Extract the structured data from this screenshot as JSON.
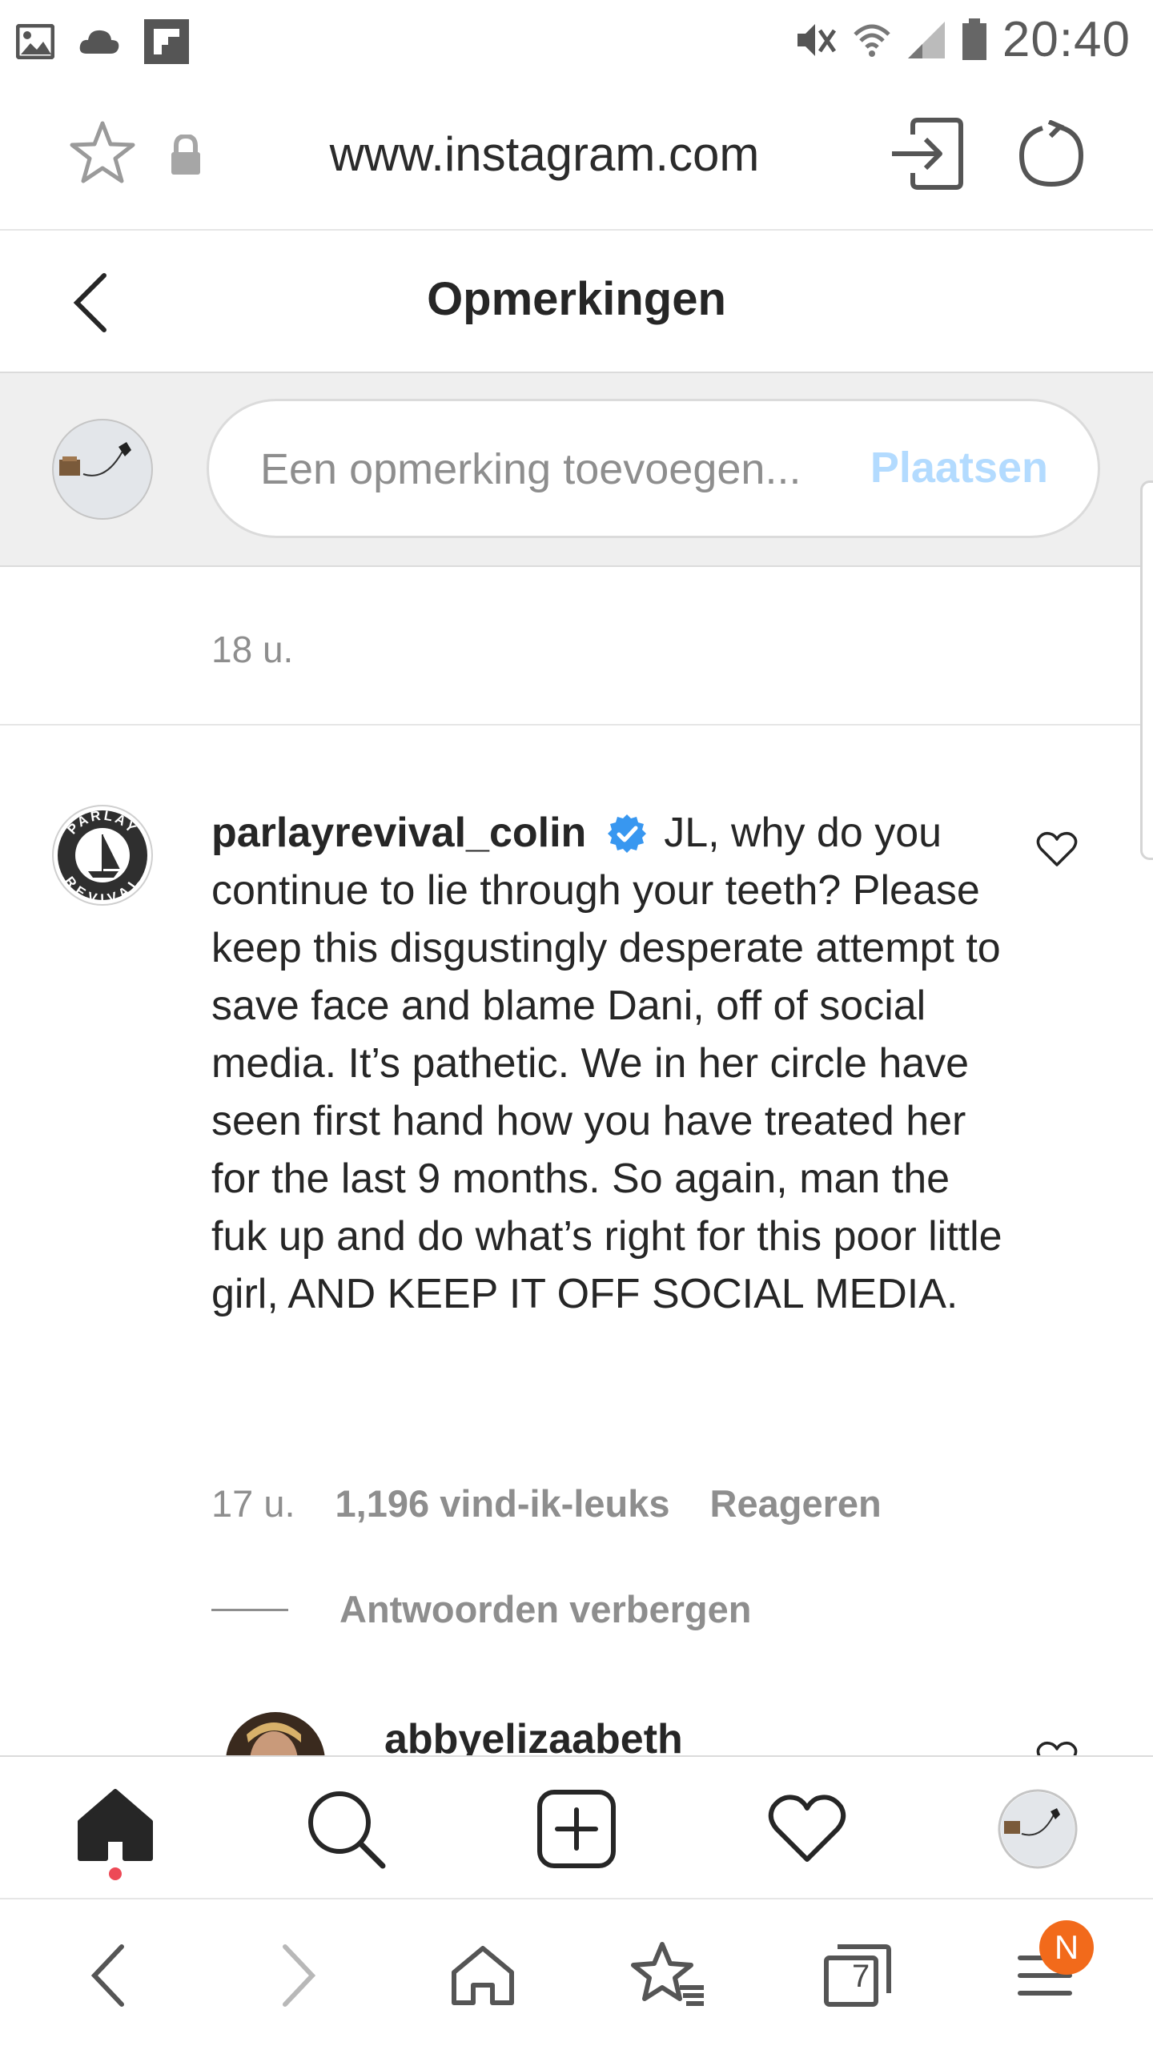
{
  "status_bar": {
    "time": "20:40",
    "left_icons": [
      "image-icon",
      "cloud-icon",
      "flipboard-icon"
    ],
    "right_icons": [
      "mute-vibrate-icon",
      "wifi-icon",
      "signal-icon",
      "battery-icon"
    ]
  },
  "browser": {
    "url": "www.instagram.com",
    "icons": [
      "star-icon",
      "lock-icon",
      "login-icon",
      "reload-icon"
    ]
  },
  "header": {
    "title": "Opmerkingen",
    "back_icon": "chevron-left-icon"
  },
  "add_comment": {
    "placeholder": "Een opmerking toevoegen...",
    "post_label": "Plaatsen",
    "post_color": "#b3dbff"
  },
  "previous_comment": {
    "time": "18 u."
  },
  "comment": {
    "username": "parlayrevival_colin",
    "verified": true,
    "verified_color": "#3897f0",
    "text": "JL, why do you continue to lie through your teeth? Please keep this disgustingly desperate attempt to save face and blame Dani, off of social media. It’s pathetic. We in her circle have seen first hand how you have treated her for the last 9 months. So again, man the fuk up and do what’s right for this poor little girl, AND KEEP IT OFF SOCIAL MEDIA.",
    "avatar_text_top": "PARLAY",
    "avatar_text_bottom": "REVIVAL",
    "time": "17 u.",
    "likes": "1,196 vind-ik-leuks",
    "reply_label": "Reageren",
    "toggle_replies": "Antwoorden verbergen"
  },
  "reply": {
    "username": "abbyelizaabeth"
  },
  "ig_nav": {
    "items": [
      "home-icon",
      "search-icon",
      "new-post-icon",
      "activity-heart-icon",
      "profile-icon"
    ],
    "notification_dot_color": "#ed4956"
  },
  "browser_nav": {
    "items": [
      "back-icon",
      "forward-icon",
      "home-icon",
      "bookmarks-icon",
      "tabs-icon",
      "menu-icon"
    ],
    "tab_count": "7",
    "menu_badge": "N",
    "menu_badge_color": "#f26a1b"
  }
}
